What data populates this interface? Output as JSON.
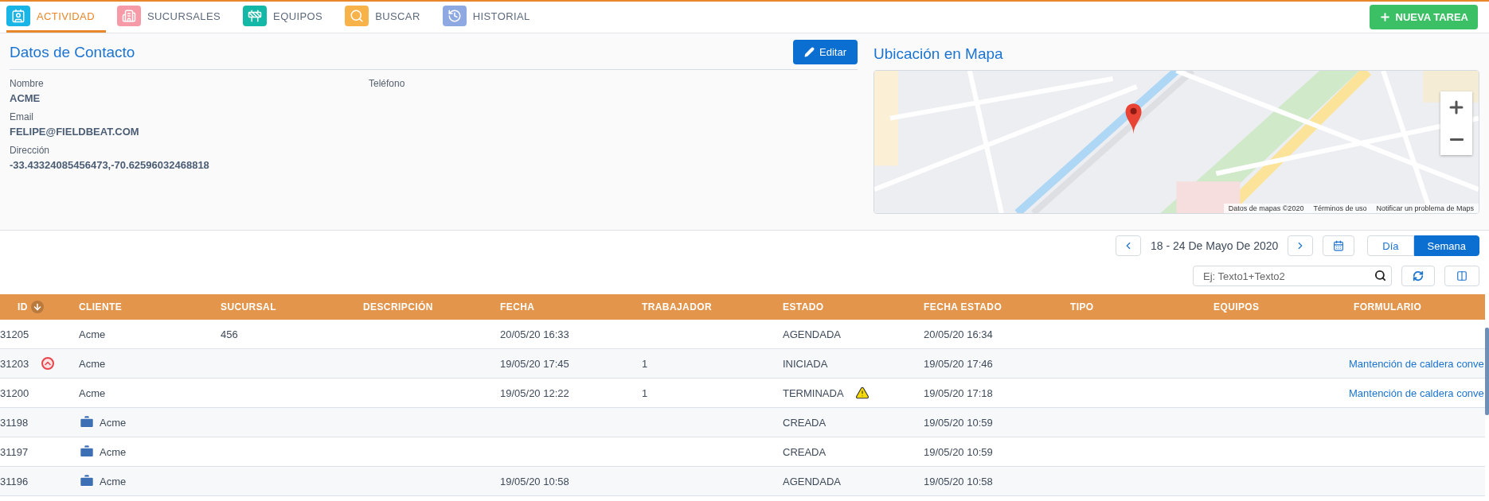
{
  "nav": {
    "tabs": [
      {
        "label": "ACTIVIDAD",
        "selected": true,
        "color": "#19b5e6"
      },
      {
        "label": "SUCURSALES",
        "selected": false,
        "color": "#f59aa6"
      },
      {
        "label": "EQUIPOS",
        "selected": false,
        "color": "#14b8a6"
      },
      {
        "label": "BUSCAR",
        "selected": false,
        "color": "#f8b24a"
      },
      {
        "label": "HISTORIAL",
        "selected": false,
        "color": "#8ea9e2"
      }
    ],
    "new_task_button": "NUEVA TAREA"
  },
  "contact": {
    "title": "Datos de Contacto",
    "edit_button": "Editar",
    "columns": [
      [
        {
          "label": "Nombre",
          "value": "ACME"
        },
        {
          "label": "Email",
          "value": "FELIPE@FIELDBEAT.COM"
        },
        {
          "label": "Dirección",
          "value": "-33.43324085456473,-70.62596032468818"
        }
      ],
      [
        {
          "label": "Teléfono"
        }
      ]
    ]
  },
  "map": {
    "title": "Ubicación en Mapa",
    "attribution": [
      "Datos de mapas ©2020",
      "Términos de uso",
      "Notificar un problema de Maps"
    ]
  },
  "calendar": {
    "range": "18 - 24 De Mayo De 2020",
    "views": [
      {
        "label": "Día",
        "selected": false
      },
      {
        "label": "Semana",
        "selected": true
      }
    ]
  },
  "search": {
    "placeholder": "Ej: Texto1+Texto2"
  },
  "table": {
    "columns": [
      {
        "label": "ID",
        "sorted": true
      },
      {
        "label": "CLIENTE",
        "sorted": false
      },
      {
        "label": "SUCURSAL",
        "sorted": false
      },
      {
        "label": "DESCRIPCIÓN",
        "sorted": false
      },
      {
        "label": "FECHA",
        "sorted": false
      },
      {
        "label": "TRABAJADOR",
        "sorted": false
      },
      {
        "label": "ESTADO",
        "sorted": false
      },
      {
        "label": "FECHA ESTADO",
        "sorted": false
      },
      {
        "label": "TIPO",
        "sorted": false
      },
      {
        "label": "EQUIPOS",
        "sorted": false
      },
      {
        "label": "FORMULARIO",
        "sorted": false
      }
    ],
    "rows": [
      {
        "cells": [
          "31205",
          "Acme",
          "456",
          null,
          "20/05/20 16:33",
          null,
          "AGENDADA",
          "20/05/20 16:34",
          null,
          null,
          null
        ],
        "urgent": false,
        "warning": false,
        "company": false
      },
      {
        "cells": [
          "31203",
          "Acme",
          null,
          null,
          "19/05/20 17:45",
          "1",
          "INICIADA",
          "19/05/20 17:46",
          null,
          null,
          "Mantención de caldera conve"
        ],
        "urgent": true,
        "warning": false,
        "company": false
      },
      {
        "cells": [
          "31200",
          "Acme",
          null,
          null,
          "19/05/20 12:22",
          "1",
          "TERMINADA",
          "19/05/20 17:18",
          null,
          null,
          "Mantención de caldera conve"
        ],
        "urgent": false,
        "warning": true,
        "company": false
      },
      {
        "cells": [
          "31198",
          "Acme",
          null,
          null,
          null,
          null,
          "CREADA",
          "19/05/20 10:59",
          null,
          null,
          null
        ],
        "urgent": false,
        "warning": false,
        "company": true
      },
      {
        "cells": [
          "31197",
          "Acme",
          null,
          null,
          null,
          null,
          "CREADA",
          "19/05/20 10:59",
          null,
          null,
          null
        ],
        "urgent": false,
        "warning": false,
        "company": true
      },
      {
        "cells": [
          "31196",
          "Acme",
          null,
          null,
          "19/05/20 10:58",
          null,
          "AGENDADA",
          "19/05/20 10:58",
          null,
          null,
          null
        ],
        "urgent": false,
        "warning": false,
        "company": true
      }
    ]
  }
}
